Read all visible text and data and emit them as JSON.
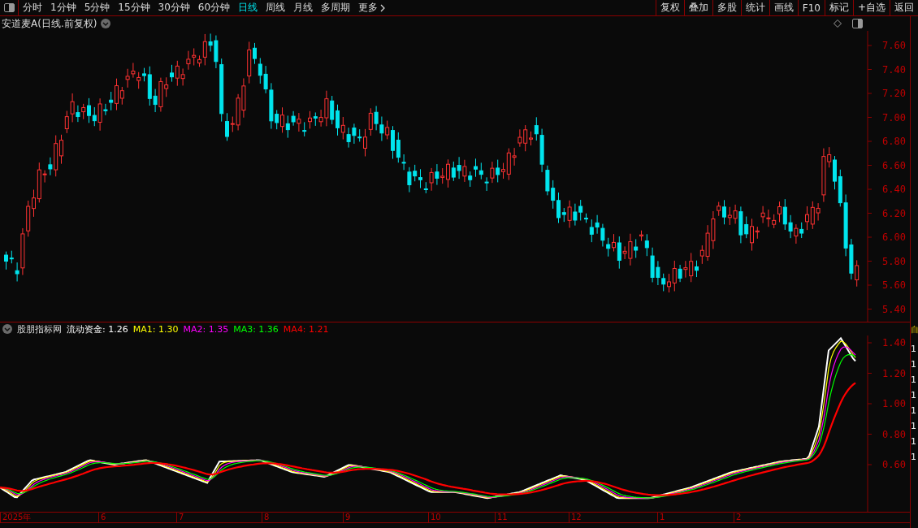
{
  "toolbar": {
    "tabs": [
      {
        "label": "分时",
        "selected": false
      },
      {
        "label": "1分钟",
        "selected": false
      },
      {
        "label": "5分钟",
        "selected": false
      },
      {
        "label": "15分钟",
        "selected": false
      },
      {
        "label": "30分钟",
        "selected": false
      },
      {
        "label": "60分钟",
        "selected": false
      },
      {
        "label": "日线",
        "selected": true
      },
      {
        "label": "周线",
        "selected": false
      },
      {
        "label": "月线",
        "selected": false
      },
      {
        "label": "多周期",
        "selected": false
      },
      {
        "label": "更多",
        "selected": false
      }
    ],
    "buttons": [
      "复权",
      "叠加",
      "多股",
      "统计",
      "画线",
      "F10",
      "标记",
      "+自选",
      "返回"
    ]
  },
  "price_chart": {
    "title": "安道麦A(日线.前复权)",
    "y_axis": [
      "7.60",
      "7.40",
      "7.20",
      "7.00",
      "6.80",
      "6.60",
      "6.40",
      "6.20",
      "6.00",
      "5.80",
      "5.60",
      "5.40"
    ]
  },
  "indicator": {
    "name": "股朋指标网",
    "series": [
      {
        "label": "流动资金:",
        "value": "1.26",
        "color": "#ffffff"
      },
      {
        "label": "MA1:",
        "value": "1.30",
        "color": "#ffff00"
      },
      {
        "label": "MA2:",
        "value": "1.35",
        "color": "#ff00ff"
      },
      {
        "label": "MA3:",
        "value": "1.36",
        "color": "#00ff00"
      },
      {
        "label": "MA4:",
        "value": "1.21",
        "color": "#ff0000"
      }
    ],
    "y_axis": [
      "1.40",
      "1.20",
      "1.00",
      "0.80",
      "0.60"
    ]
  },
  "date_axis": [
    "2025年",
    "6",
    "7",
    "8",
    "9",
    "10",
    "11",
    "12",
    "1",
    "2"
  ],
  "side_panel": {
    "badge": "自",
    "rows": [
      "1",
      "1",
      "1",
      "1",
      "1",
      "1",
      "1",
      "1"
    ]
  }
}
